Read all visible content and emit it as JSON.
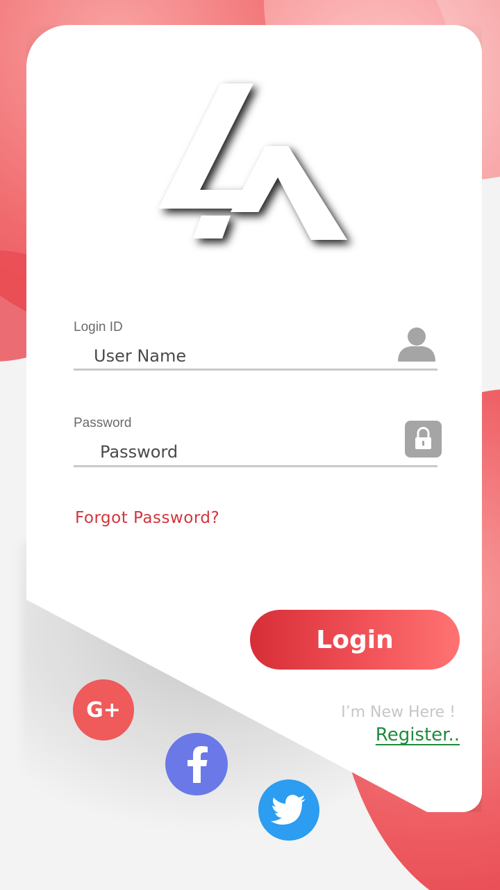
{
  "login": {
    "id_label": "Login ID",
    "username_placeholder": "User Name",
    "password_label": "Password",
    "password_placeholder": "Password",
    "forgot_link": "Forgot Password?",
    "login_button": "Login"
  },
  "register": {
    "prompt": "I’m New Here !",
    "link": "Register.."
  },
  "social": {
    "google_label": "G+",
    "icons": [
      "google-plus-icon",
      "facebook-icon",
      "twitter-icon"
    ]
  },
  "colors": {
    "accent_red": "#d72e38",
    "register_green": "#1f8a3f",
    "google": "#ef5a5a",
    "facebook": "#6a78e8",
    "twitter": "#2c9df0"
  }
}
